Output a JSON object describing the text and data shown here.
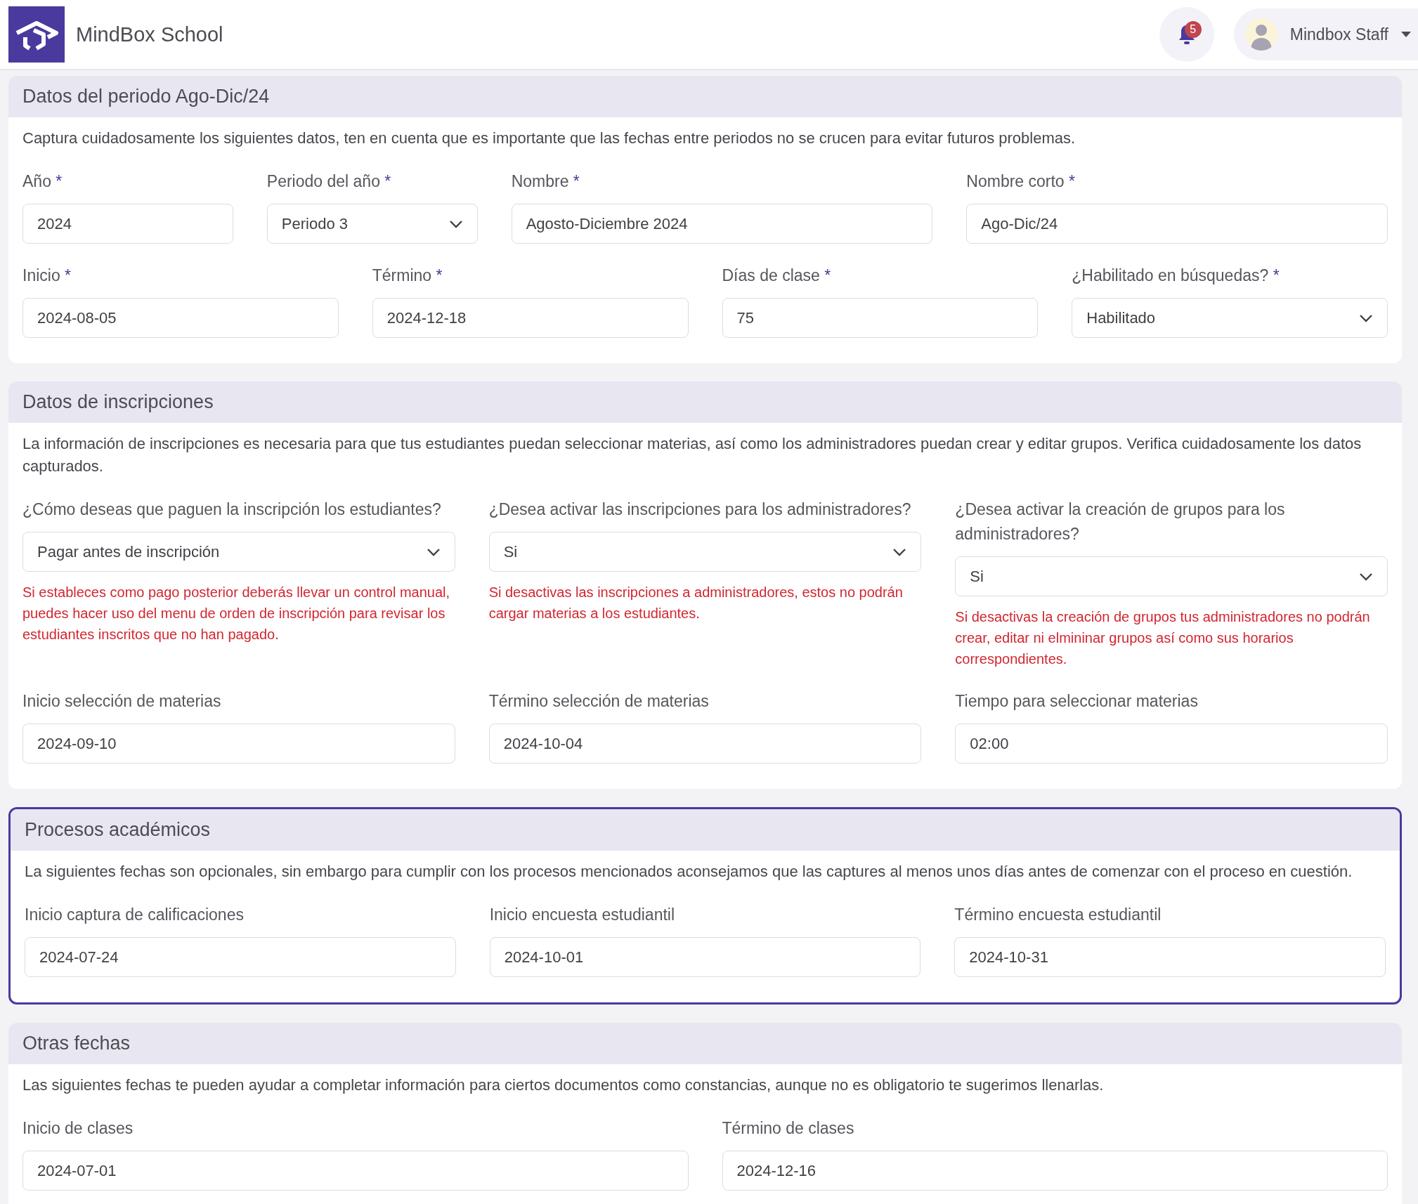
{
  "header": {
    "brand": "MindBox School",
    "notifications": {
      "count": "5"
    },
    "user": {
      "name": "Mindbox Staff"
    }
  },
  "sections": [
    {
      "title": "Datos del periodo Ago-Dic/24",
      "highlighted": false,
      "description": "Captura cuidadosamente los siguientes datos, ten en cuenta que es importante que las fechas entre periodos no se crucen para evitar futuros problemas.",
      "rows": [
        {
          "fields": [
            {
              "label": "Año",
              "mark": "*",
              "kind": "text",
              "value": "2024"
            },
            {
              "label": "Periodo del año",
              "mark": "*",
              "kind": "select",
              "value": "Periodo 3"
            },
            {
              "label": "Nombre",
              "mark": "*",
              "kind": "text",
              "value": "Agosto-Diciembre 2024"
            },
            {
              "label": "Nombre corto",
              "mark": "*",
              "kind": "text",
              "value": "Ago-Dic/24"
            }
          ]
        },
        {
          "fields": [
            {
              "label": "Inicio",
              "mark": "*",
              "kind": "text",
              "value": "2024-08-05"
            },
            {
              "label": "Término",
              "mark": "*",
              "kind": "text",
              "value": "2024-12-18"
            },
            {
              "label": "Días de clase",
              "mark": "*",
              "kind": "text",
              "value": "75"
            },
            {
              "label": "¿Habilitado en búsquedas?",
              "mark": "*",
              "kind": "select",
              "value": "Habilitado"
            }
          ]
        }
      ]
    },
    {
      "title": "Datos de inscripciones",
      "highlighted": false,
      "description": "La información de inscripciones es necesaria para que tus estudiantes puedan seleccionar materias, así como los administradores puedan crear y editar grupos. Verifica cuidadosamente los datos capturados.",
      "rows": [
        {
          "fields": [
            {
              "label": "¿Cómo deseas que paguen la inscripción los estudiantes?",
              "kind": "select",
              "value": "Pagar antes de inscripción",
              "warning": "Si estableces como pago posterior deberás llevar un control manual, puedes hacer uso del menu de orden de inscripción para revisar los estudiantes inscritos que no han pagado."
            },
            {
              "label": "¿Desea activar las inscripciones para los administradores?",
              "kind": "select",
              "value": "Si",
              "warning": "Si desactivas las inscripciones a administradores, estos no podrán cargar materias a los estudiantes."
            },
            {
              "label": "¿Desea activar la creación de grupos para los administradores?",
              "kind": "select",
              "value": "Si",
              "warning": "Si desactivas la creación de grupos tus administradores no podrán crear, editar ni elmininar grupos así como sus horarios correspondientes."
            }
          ]
        },
        {
          "fields": [
            {
              "label": "Inicio selección de materias",
              "kind": "text",
              "value": "2024-09-10"
            },
            {
              "label": "Término selección de materias",
              "kind": "text",
              "value": "2024-10-04"
            },
            {
              "label": "Tiempo para seleccionar materias",
              "kind": "text",
              "value": "02:00"
            }
          ]
        }
      ]
    },
    {
      "title": "Procesos académicos",
      "highlighted": true,
      "description": "La siguientes fechas son opcionales, sin embargo para cumplir con los procesos mencionados aconsejamos que las captures al menos unos días antes de comenzar con el proceso en cuestión.",
      "rows": [
        {
          "fields": [
            {
              "label": "Inicio captura de calificaciones",
              "kind": "text",
              "value": "2024-07-24"
            },
            {
              "label": "Inicio encuesta estudiantil",
              "kind": "text",
              "value": "2024-10-01"
            },
            {
              "label": "Término encuesta estudiantil",
              "kind": "text",
              "value": "2024-10-31"
            }
          ]
        }
      ]
    },
    {
      "title": "Otras fechas",
      "highlighted": false,
      "description": "Las siguientes fechas te pueden ayudar a completar información para ciertos documentos como constancias, aunque no es obligatorio te sugerimos llenarlas.",
      "rows": [
        {
          "fields": [
            {
              "label": "Inicio de clases",
              "kind": "text",
              "value": "2024-07-01"
            },
            {
              "label": "Término de clases",
              "kind": "text",
              "value": "2024-12-16"
            }
          ]
        }
      ]
    }
  ]
}
